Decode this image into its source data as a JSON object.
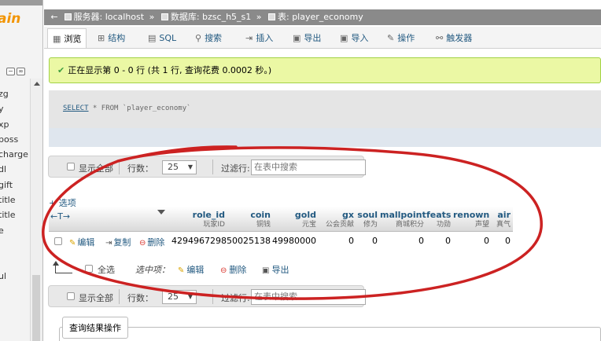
{
  "nav": {
    "logo": "ain",
    "items": [
      "zg",
      "y",
      "xp",
      "boss",
      "charge",
      "dl",
      "gift",
      "title",
      "title",
      "e",
      "",
      "",
      "ul"
    ]
  },
  "breadcrumb": {
    "server_label": "服务器: localhost",
    "db_label": "数据库: bzsc_h5_s1",
    "table_label": "表: player_economy",
    "sep": "»"
  },
  "tabs": [
    {
      "label": "浏览",
      "icon": "browse-icon"
    },
    {
      "label": "结构",
      "icon": "structure-icon"
    },
    {
      "label": "SQL",
      "icon": "sql-icon"
    },
    {
      "label": "搜索",
      "icon": "search-icon"
    },
    {
      "label": "插入",
      "icon": "insert-icon"
    },
    {
      "label": "导出",
      "icon": "export-icon"
    },
    {
      "label": "导入",
      "icon": "import-icon"
    },
    {
      "label": "操作",
      "icon": "wrench-icon"
    },
    {
      "label": "触发器",
      "icon": "trigger-icon"
    }
  ],
  "message": "正在显示第 0 - 0 行 (共 1 行, 查询花费 0.0002 秒。)",
  "sql": {
    "keyword": "SELECT",
    "rest": " * FROM `player_economy`"
  },
  "toolbar": {
    "show_all": "显示全部",
    "rows_label": "行数：",
    "rows_value": "25",
    "filter_label": "过滤行:",
    "filter_placeholder": "在表中搜索"
  },
  "options_link": "+ 选项",
  "col_controls": "←T→",
  "columns": [
    {
      "name": "role_id",
      "comment": "玩家ID"
    },
    {
      "name": "coin",
      "comment": "铜钱"
    },
    {
      "name": "gold",
      "comment": "元宝"
    },
    {
      "name": "gx",
      "comment": "公会贡献"
    },
    {
      "name": "soul",
      "comment": "修为"
    },
    {
      "name": "mallpoint",
      "comment": "商城积分"
    },
    {
      "name": "feats",
      "comment": "功勋"
    },
    {
      "name": "renown",
      "comment": "声望"
    },
    {
      "name": "air",
      "comment": "真气"
    }
  ],
  "row": {
    "edit": "编辑",
    "copy": "复制",
    "delete": "删除",
    "values": [
      "4294967298",
      "50025138",
      "49980000",
      "0",
      "0",
      "0",
      "0",
      "0",
      "0"
    ]
  },
  "bulk": {
    "check_all": "全选",
    "selected_label": "选中项：",
    "edit": "编辑",
    "delete": "删除",
    "export": "导出"
  },
  "bottom_toolbar": {
    "show_all": "显示全部",
    "rows_label": "行数：",
    "rows_value": "25",
    "filter_label": "过滤行:",
    "filter_placeholder": "在表中搜索"
  },
  "query_ops_legend": "查询结果操作",
  "colors": {
    "annotation": "#cc2222",
    "message_bg": "#ebf8a4",
    "link": "#235a81"
  }
}
